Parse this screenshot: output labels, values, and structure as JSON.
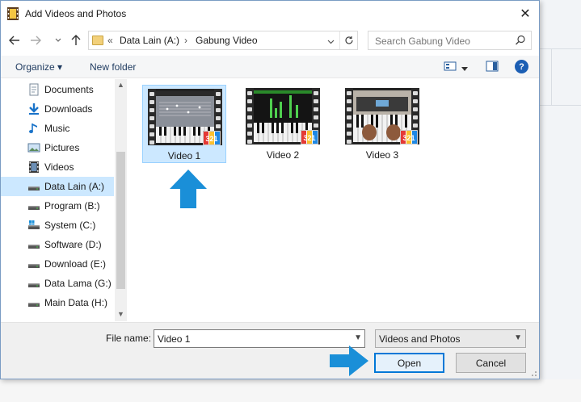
{
  "window": {
    "title": "Add Videos and Photos",
    "close_label": "✕"
  },
  "address": {
    "overflow": "«",
    "parts": [
      "Data Lain (A:)",
      "Gabung Video"
    ],
    "separator": "›"
  },
  "search": {
    "placeholder": "Search Gabung Video"
  },
  "toolbar": {
    "organize_label": "Organize ▾",
    "new_folder_label": "New folder",
    "help_label": "?"
  },
  "sidebar": {
    "items": [
      {
        "label": "Documents",
        "icon": "documents-icon"
      },
      {
        "label": "Downloads",
        "icon": "downloads-icon"
      },
      {
        "label": "Music",
        "icon": "music-icon"
      },
      {
        "label": "Pictures",
        "icon": "pictures-icon"
      },
      {
        "label": "Videos",
        "icon": "videos-icon"
      },
      {
        "label": "Data Lain (A:)",
        "icon": "drive-icon",
        "selected": true
      },
      {
        "label": "Program (B:)",
        "icon": "drive-icon"
      },
      {
        "label": "System (C:)",
        "icon": "system-drive-icon"
      },
      {
        "label": "Software (D:)",
        "icon": "drive-icon"
      },
      {
        "label": "Download (E:)",
        "icon": "drive-icon"
      },
      {
        "label": "Data Lama (G:)",
        "icon": "drive-icon"
      },
      {
        "label": "Main Data (H:)",
        "icon": "drive-icon"
      }
    ]
  },
  "files": [
    {
      "name": "Video 1",
      "selected": true
    },
    {
      "name": "Video 2",
      "selected": false
    },
    {
      "name": "Video 3",
      "selected": false
    }
  ],
  "footer": {
    "file_name_label": "File name:",
    "file_name_value": "Video 1",
    "file_type_value": "Videos and Photos",
    "open_label": "Open",
    "cancel_label": "Cancel"
  },
  "colors": {
    "accent": "#0078d7",
    "selection": "#cce8ff",
    "arrow": "#1a8fd8"
  }
}
